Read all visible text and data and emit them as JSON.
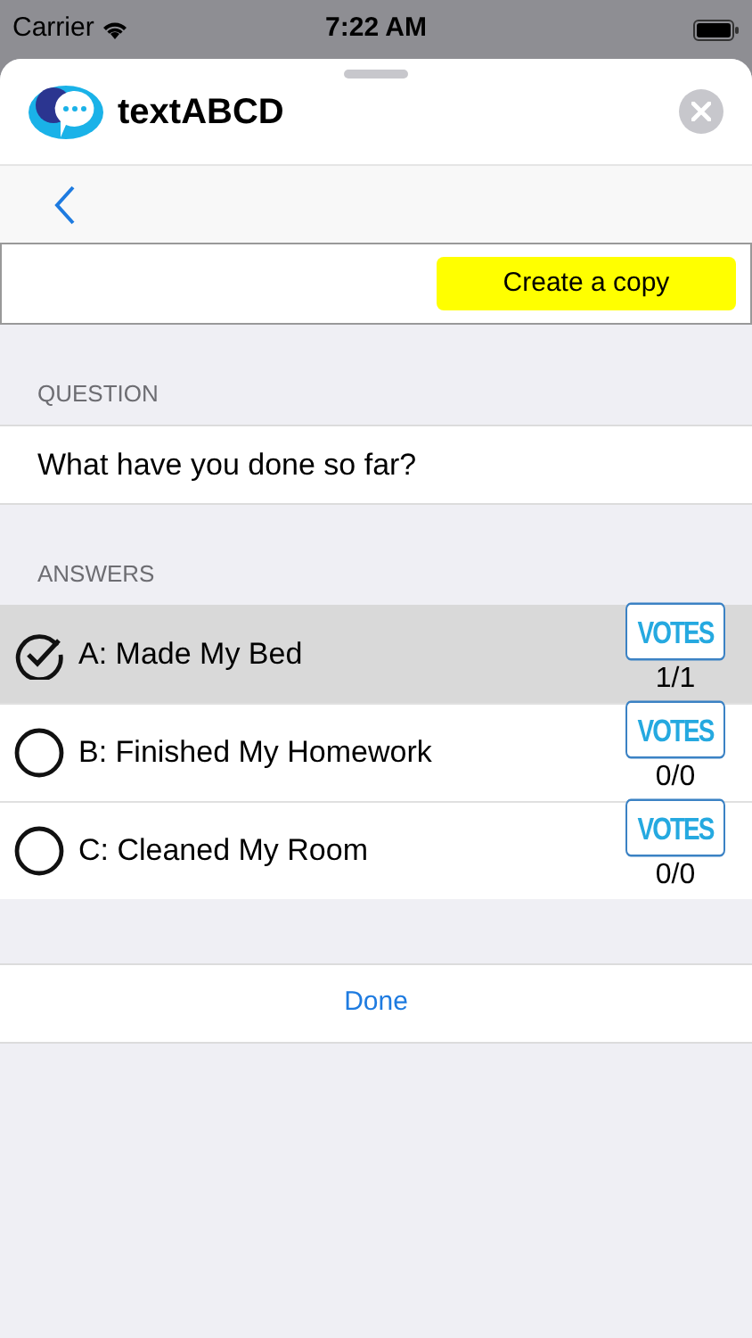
{
  "status_bar": {
    "carrier": "Carrier",
    "time": "7:22 AM"
  },
  "sheet": {
    "title": "textABCD"
  },
  "copy_button": "Create a copy",
  "question": {
    "header": "QUESTION",
    "text": "What have you done so far?"
  },
  "answers": {
    "header": "ANSWERS",
    "items": [
      {
        "label": "A: Made My Bed",
        "selected": true,
        "votes_label": "VOTES",
        "count": "1/1"
      },
      {
        "label": "B: Finished My Homework",
        "selected": false,
        "votes_label": "VOTES",
        "count": "0/0"
      },
      {
        "label": "C: Cleaned My Room",
        "selected": false,
        "votes_label": "VOTES",
        "count": "0/0"
      }
    ]
  },
  "done_button": "Done"
}
